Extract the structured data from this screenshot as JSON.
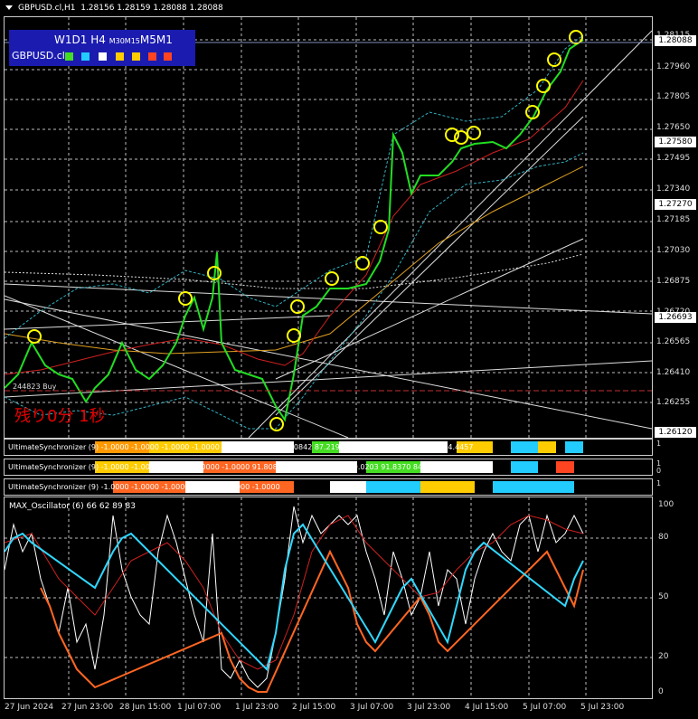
{
  "header": {
    "symbol_tf": "GBPUSD.cl,H1",
    "ohlc": "1.28156 1.28159 1.28088 1.28088"
  },
  "timeframe_panel": {
    "label_big1": "W1D1",
    "label_big2": "H4",
    "label_small": "M30M15",
    "label_big3": "M5M1",
    "symbol": "GBPUSD.cl",
    "swatches": [
      "#44dd22",
      "#22ccff",
      "#ffffff",
      "#ffcc00",
      "#ffcc00",
      "#ff4422",
      "#ff4422"
    ]
  },
  "countdown": "残り0分 1秒",
  "order_label": "Buy",
  "order_price": "244823",
  "price_scale": [
    "1.28115",
    "1.27960",
    "1.27805",
    "1.27650",
    "1.27495",
    "1.27340",
    "1.27185",
    "1.27030",
    "1.26875",
    "1.26720",
    "1.26565",
    "1.26410",
    "1.26255"
  ],
  "price_boxes": {
    "current": "1.28088",
    "level1": "1.27580",
    "level2": "1.27270",
    "level3": "1.26693",
    "level4": "1.26120"
  },
  "bands": [
    {
      "label": "UltimateSynchronizer (9) -1.0000 -1.0000 -1.0000 -1.0000 -1.0000 -1.0000 96.0842 87.2197 77.9240 84.1901 78.9425 84.4457"
    },
    {
      "label": "UltimateSynchronizer (9) -1.0000 -1.0000 -1.0000 -1.0000 -1.0000 91.8081 93.4451 84.5185 89.0203 91.8370 84.9532"
    },
    {
      "label": "UltimateSynchronizer (9) -1.0000 -1.0000 -1.0000 -1.0000 -1.0000 -1.0000"
    }
  ],
  "band_scale": [
    "1",
    "0"
  ],
  "oscillator": {
    "label": "MAX_Oscillator (6) 66 62 89 83",
    "scale": [
      "100",
      "80",
      "50",
      "20",
      "0"
    ]
  },
  "time_axis": [
    "27 Jun 2024",
    "27 Jun 23:00",
    "28 Jun 15:00",
    "1 Jul 07:00",
    "1 Jul 23:00",
    "2 Jul 15:00",
    "3 Jul 07:00",
    "3 Jul 23:00",
    "4 Jul 15:00",
    "5 Jul 07:00",
    "5 Jul 23:00"
  ]
}
